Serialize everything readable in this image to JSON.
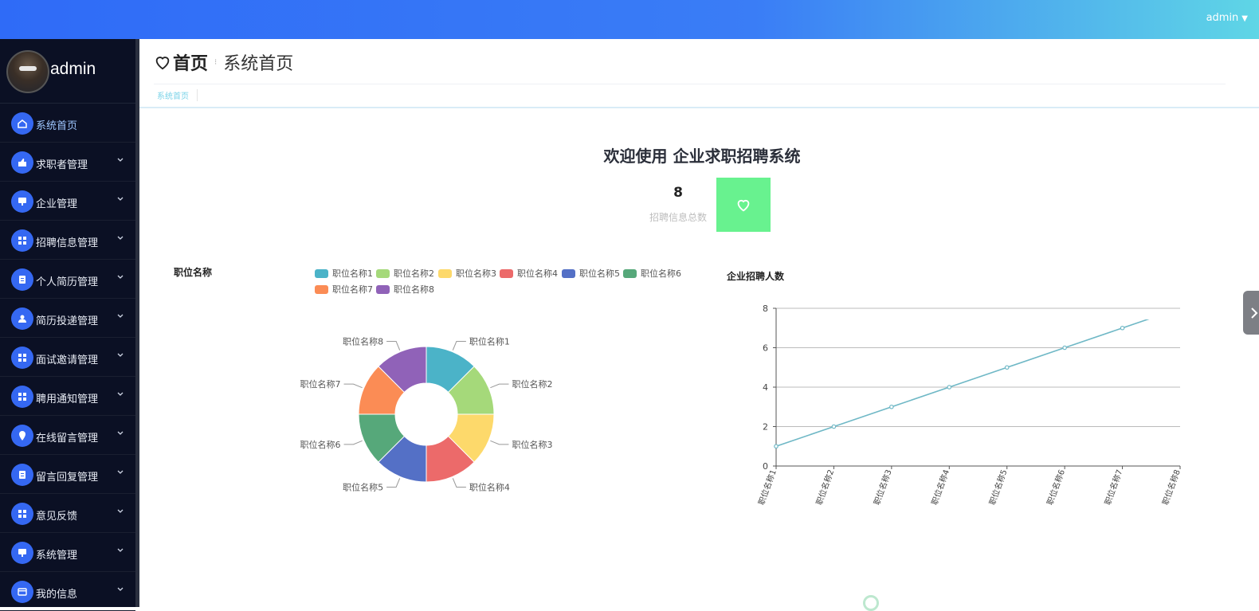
{
  "topbar": {
    "user": "admin"
  },
  "sidebar": {
    "profile_name": "admin",
    "items": [
      {
        "label": "系统首页",
        "icon": "home-icon",
        "active": true,
        "chevron": false
      },
      {
        "label": "求职者管理",
        "icon": "thumb-up-icon",
        "chevron": true
      },
      {
        "label": "企业管理",
        "icon": "monitor-icon",
        "chevron": true
      },
      {
        "label": "招聘信息管理",
        "icon": "grid-icon",
        "chevron": true
      },
      {
        "label": "个人简历管理",
        "icon": "clipboard-icon",
        "chevron": true
      },
      {
        "label": "简历投递管理",
        "icon": "user-icon",
        "chevron": true
      },
      {
        "label": "面试邀请管理",
        "icon": "grid-icon",
        "chevron": true
      },
      {
        "label": "聘用通知管理",
        "icon": "grid-icon",
        "chevron": true
      },
      {
        "label": "在线留言管理",
        "icon": "location-icon",
        "chevron": true
      },
      {
        "label": "留言回复管理",
        "icon": "clipboard-icon",
        "chevron": true
      },
      {
        "label": "意见反馈",
        "icon": "grid-icon",
        "chevron": true
      },
      {
        "label": "系统管理",
        "icon": "monitor-icon",
        "chevron": true
      },
      {
        "label": "我的信息",
        "icon": "card-icon",
        "chevron": true
      }
    ]
  },
  "header": {
    "title": "首页",
    "separator": "⁝",
    "subtitle": "系统首页"
  },
  "tabs": [
    {
      "label": "系统首页"
    }
  ],
  "welcome": "欢迎使用 企业求职招聘系统",
  "stat": {
    "value": "8",
    "label": "招聘信息总数",
    "color": "#68f28f",
    "icon": "heart-icon"
  },
  "chart_data": [
    {
      "type": "pie",
      "title": "职位名称",
      "donut": true,
      "categories": [
        "职位名称1",
        "职位名称2",
        "职位名称3",
        "职位名称4",
        "职位名称5",
        "职位名称6",
        "职位名称7",
        "职位名称8"
      ],
      "values": [
        1,
        1,
        1,
        1,
        1,
        1,
        1,
        1
      ],
      "colors": [
        "#4bb3c8",
        "#a5d97a",
        "#fdd96b",
        "#ec6a6a",
        "#5470c6",
        "#56a87a",
        "#fb8c55",
        "#9062b8"
      ],
      "legend": "top"
    },
    {
      "type": "line",
      "title": "企业招聘人数",
      "categories": [
        "职位名称1",
        "职位名称2",
        "职位名称3",
        "职位名称4",
        "职位名称5",
        "职位名称6",
        "职位名称7",
        "职位名称8"
      ],
      "values": [
        1,
        2,
        3,
        4,
        5,
        6,
        7,
        8
      ],
      "ylim": [
        0,
        8
      ],
      "yticks": [
        0,
        2,
        4,
        6,
        8
      ],
      "grid": true,
      "color": "#6fb8c6"
    }
  ]
}
